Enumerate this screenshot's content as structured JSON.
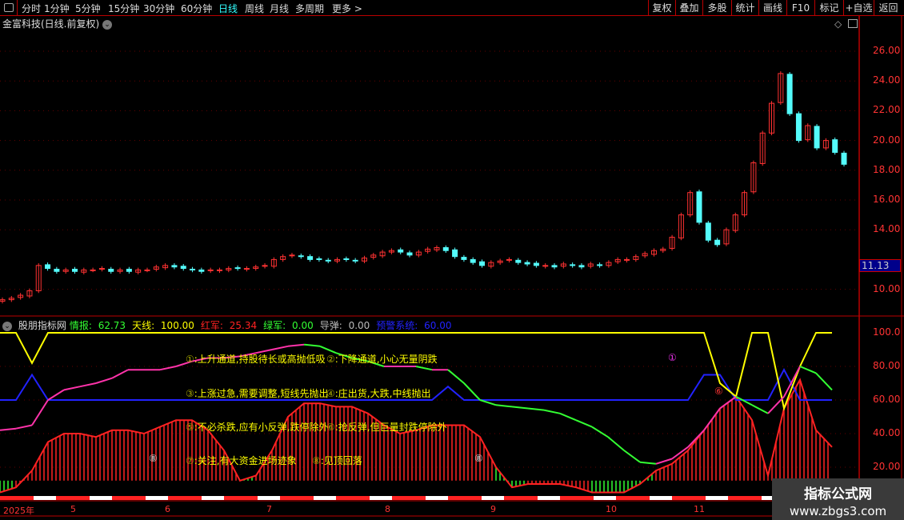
{
  "topbar": {
    "periods": [
      "分时",
      "1分钟",
      "5分钟",
      "15分钟",
      "30分钟",
      "60分钟",
      "日线",
      "周线",
      "月线",
      "多周期",
      "更多 >"
    ],
    "active": "日线",
    "right_buttons": [
      "复权",
      "叠加",
      "多股",
      "统计",
      "画线",
      "F10",
      "标记",
      "+自选",
      "返回"
    ]
  },
  "stock": {
    "title": "金富科技(日线.前复权)",
    "last_price": "11.13"
  },
  "price_axis": [
    "26.00",
    "24.00",
    "22.00",
    "20.00",
    "18.00",
    "16.00",
    "14.00",
    "10.00"
  ],
  "indicator": {
    "name": "股朋指标网",
    "fields": [
      {
        "label": "情报: ",
        "value": "62.73",
        "color": "#3f3"
      },
      {
        "label": "天线: ",
        "value": "100.00",
        "color": "#ff0"
      },
      {
        "label": "红军: ",
        "value": "25.34",
        "color": "#f22"
      },
      {
        "label": "绿军: ",
        "value": "0.00",
        "color": "#3f3"
      },
      {
        "label": "导弹: ",
        "value": "0.00",
        "color": "#bbb"
      },
      {
        "label": "预警系统: ",
        "value": "60.00",
        "color": "#22f"
      }
    ],
    "axis": [
      "100.0",
      "80.00",
      "60.00",
      "40.00",
      "20.00"
    ],
    "legend": [
      {
        "n": "①",
        "t": ":上升通道,持股待长或高抛低吸"
      },
      {
        "n": "②",
        "t": ":下降通道,小心无量阴跌"
      },
      {
        "n": "③",
        "t": ":上涨过急,需要调整,短线先抛出"
      },
      {
        "n": "④",
        "t": ":庄出货,大跌,中线抛出"
      },
      {
        "n": "⑤",
        "t": ":不必杀跌,应有小反弹,跌停除外"
      },
      {
        "n": "⑥",
        "t": ":抢反弹,但巨量封跌停除外"
      },
      {
        "n": "⑦",
        "t": ":关注,有大资金进场迹象"
      },
      {
        "n": "⑧",
        "t": ":见顶回落"
      }
    ],
    "marks": [
      "⑧",
      "⑧",
      "①",
      "⑥"
    ]
  },
  "dates": [
    "2025年",
    "5",
    "6",
    "7",
    "8",
    "9",
    "10",
    "11"
  ],
  "watermark": {
    "title": "指标公式网",
    "url": "www.zbgs3.com"
  },
  "colors": {
    "up": "#ff3232",
    "down": "#54fcfc",
    "axis": "#b00"
  },
  "chart_data": {
    "type": "candlestick+indicator",
    "closes": [
      9.3,
      9.4,
      9.6,
      9.9,
      11.6,
      11.4,
      11.2,
      11.3,
      11.2,
      11.3,
      11.3,
      11.4,
      11.2,
      11.3,
      11.2,
      11.3,
      11.3,
      11.5,
      11.6,
      11.5,
      11.4,
      11.3,
      11.2,
      11.3,
      11.3,
      11.4,
      11.4,
      11.4,
      11.5,
      11.6,
      12.0,
      12.2,
      12.3,
      12.2,
      12.0,
      12.0,
      11.9,
      12.0,
      12.0,
      11.9,
      12.1,
      12.3,
      12.5,
      12.6,
      12.5,
      12.3,
      12.5,
      12.7,
      12.8,
      12.6,
      12.2,
      12.0,
      11.8,
      11.6,
      11.8,
      11.9,
      12.0,
      11.8,
      11.7,
      11.6,
      11.6,
      11.5,
      11.7,
      11.6,
      11.5,
      11.7,
      11.6,
      11.8,
      12.0,
      12.0,
      12.2,
      12.4,
      12.6,
      12.7,
      13.5,
      15.0,
      16.5,
      14.5,
      13.3,
      13.0,
      14.0,
      15.0,
      16.5,
      18.5,
      20.5,
      22.5,
      24.5,
      21.8,
      20.0,
      21.0,
      19.5,
      20.0,
      19.2,
      18.4
    ],
    "x_step": 20,
    "red": [
      5,
      8,
      18,
      35,
      40,
      40,
      38,
      42,
      42,
      40,
      44,
      48,
      48,
      42,
      30,
      12,
      15,
      30,
      50,
      58,
      58,
      56,
      56,
      52,
      45,
      40,
      42,
      45,
      45,
      45,
      38,
      20,
      8,
      10,
      10,
      10,
      8,
      5,
      5,
      5,
      10,
      18,
      22,
      30,
      42,
      55,
      62,
      48,
      15,
      55,
      72,
      42,
      32
    ],
    "green_idx": [
      0,
      15,
      31,
      32,
      37,
      38,
      39,
      40
    ],
    "info": [
      42,
      43,
      45,
      60,
      66,
      68,
      70,
      73,
      78,
      78,
      78,
      80,
      83,
      85,
      85,
      86,
      88,
      90,
      92,
      93,
      92,
      88,
      85,
      83,
      80,
      80,
      80,
      78,
      78,
      70,
      60,
      57,
      56,
      55,
      54,
      52,
      48,
      44,
      38,
      30,
      23,
      22,
      25,
      32,
      42,
      55,
      62,
      57,
      52,
      62,
      80,
      76,
      66
    ],
    "sky": [
      100,
      100,
      82,
      100,
      100,
      100,
      100,
      100,
      100,
      100,
      100,
      100,
      100,
      100,
      100,
      100,
      100,
      100,
      100,
      100,
      100,
      100,
      100,
      100,
      100,
      100,
      100,
      100,
      100,
      100,
      100,
      100,
      100,
      100,
      100,
      100,
      100,
      100,
      100,
      100,
      100,
      100,
      100,
      100,
      100,
      70,
      62,
      100,
      100,
      55,
      80,
      100,
      100
    ],
    "warn": [
      60,
      60,
      75,
      60,
      60,
      60,
      60,
      60,
      60,
      60,
      60,
      60,
      60,
      60,
      60,
      60,
      60,
      60,
      60,
      60,
      60,
      60,
      60,
      60,
      60,
      60,
      60,
      60,
      68,
      60,
      60,
      60,
      60,
      60,
      60,
      60,
      60,
      60,
      60,
      60,
      60,
      60,
      60,
      60,
      75,
      75,
      60,
      60,
      60,
      78,
      60,
      60,
      60
    ],
    "price_ylim": [
      10,
      26
    ],
    "ind_ylim": [
      20,
      100
    ]
  }
}
